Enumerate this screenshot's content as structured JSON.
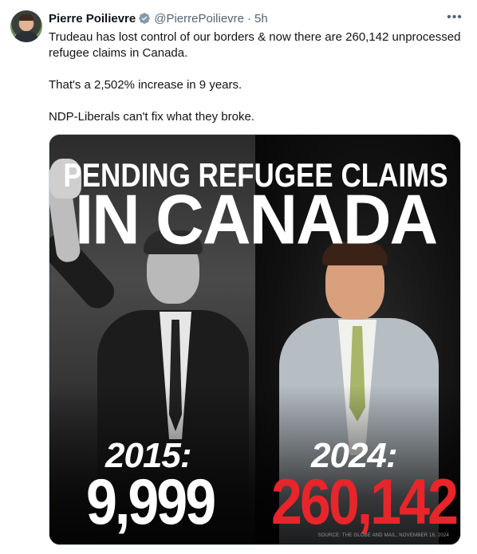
{
  "author": {
    "name": "Pierre Poilievre",
    "handle": "@PierrePoilievre",
    "separator": "·",
    "time": "5h",
    "more_label": "•••"
  },
  "tweet": {
    "line1": "Trudeau has lost control of our borders & now there are 260,142 unprocessed refugee claims in Canada.",
    "line2": "That's a 2,502% increase in 9 years.",
    "line3": "NDP-Liberals can't fix what they broke."
  },
  "image": {
    "headline_top": "PENDING REFUGEE CLAIMS",
    "headline_main": "IN CANADA",
    "left_year": "2015:",
    "left_value": "9,999",
    "right_year": "2024:",
    "right_value": "260,142",
    "source": "SOURCE: THE GLOBE AND MAIL, NOVEMBER 16, 2024"
  },
  "colors": {
    "verified_badge": "#829aab",
    "accent_red": "#e8252a",
    "secondary_text": "#536471"
  }
}
